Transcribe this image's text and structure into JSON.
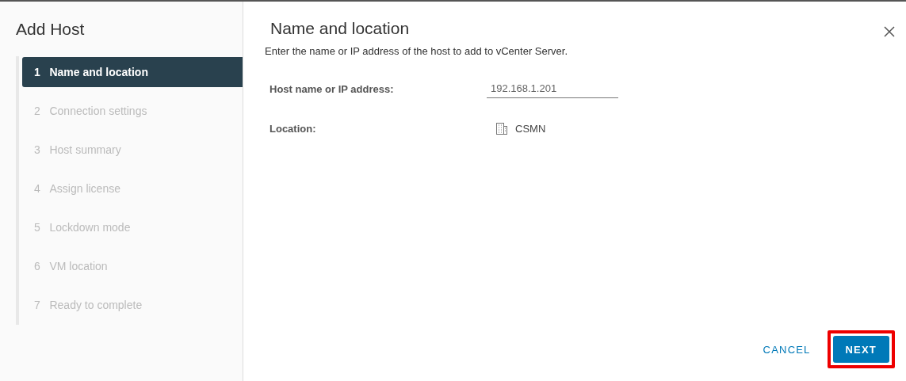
{
  "wizard": {
    "title": "Add Host",
    "steps": [
      {
        "number": "1",
        "label": "Name and location",
        "selected": true
      },
      {
        "number": "2",
        "label": "Connection settings",
        "selected": false
      },
      {
        "number": "3",
        "label": "Host summary",
        "selected": false
      },
      {
        "number": "4",
        "label": "Assign license",
        "selected": false
      },
      {
        "number": "5",
        "label": "Lockdown mode",
        "selected": false
      },
      {
        "number": "6",
        "label": "VM location",
        "selected": false
      },
      {
        "number": "7",
        "label": "Ready to complete",
        "selected": false
      }
    ]
  },
  "page": {
    "title": "Name and location",
    "description": "Enter the name or IP address of the host to add to vCenter Server.",
    "fields": [
      {
        "kind": "input",
        "label": "Host name or IP address:",
        "value": "192.168.1.201"
      },
      {
        "kind": "location",
        "label": "Location:",
        "value": "CSMN"
      }
    ]
  },
  "buttons": [
    {
      "kind": "flat",
      "label": "CANCEL",
      "highlighted": false
    },
    {
      "kind": "primary",
      "label": "NEXT",
      "highlighted": true
    }
  ]
}
